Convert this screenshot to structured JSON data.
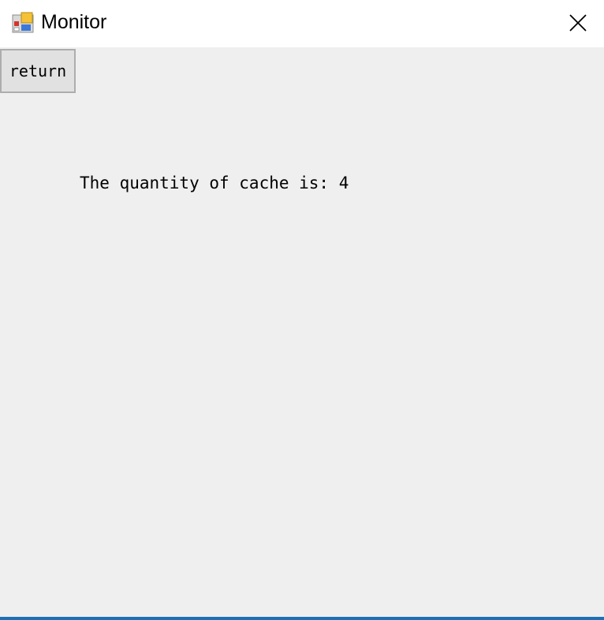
{
  "window": {
    "title": "Monitor",
    "app_icon": "form-app-icon",
    "close_icon": "close-icon",
    "accent_color": "#1e6fb3"
  },
  "toolbar": {
    "return_label": "return"
  },
  "content": {
    "cache_text": "The quantity of cache is: 4"
  }
}
